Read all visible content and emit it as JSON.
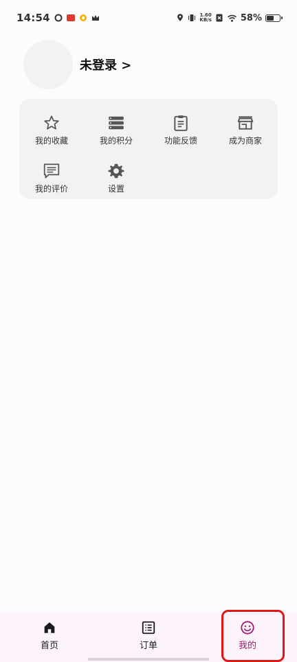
{
  "status_bar": {
    "time": "14:54",
    "net_speed_value": "1.60",
    "net_speed_unit": "KB/s",
    "battery_percent": "58%",
    "battery_level": 0.58
  },
  "profile": {
    "login_label": "未登录 >"
  },
  "menu": {
    "items": [
      {
        "label": "我的收藏",
        "icon": "star-icon"
      },
      {
        "label": "我的积分",
        "icon": "list-stack-icon"
      },
      {
        "label": "功能反馈",
        "icon": "clipboard-icon"
      },
      {
        "label": "成为商家",
        "icon": "store-icon"
      },
      {
        "label": "我的评价",
        "icon": "comment-icon"
      },
      {
        "label": "设置",
        "icon": "gear-icon"
      }
    ]
  },
  "bottom_nav": {
    "items": [
      {
        "label": "首页",
        "icon": "home-icon"
      },
      {
        "label": "订单",
        "icon": "order-list-icon"
      },
      {
        "label": "我的",
        "icon": "smile-icon",
        "active": true
      }
    ],
    "active_color": "#9a1f74"
  }
}
